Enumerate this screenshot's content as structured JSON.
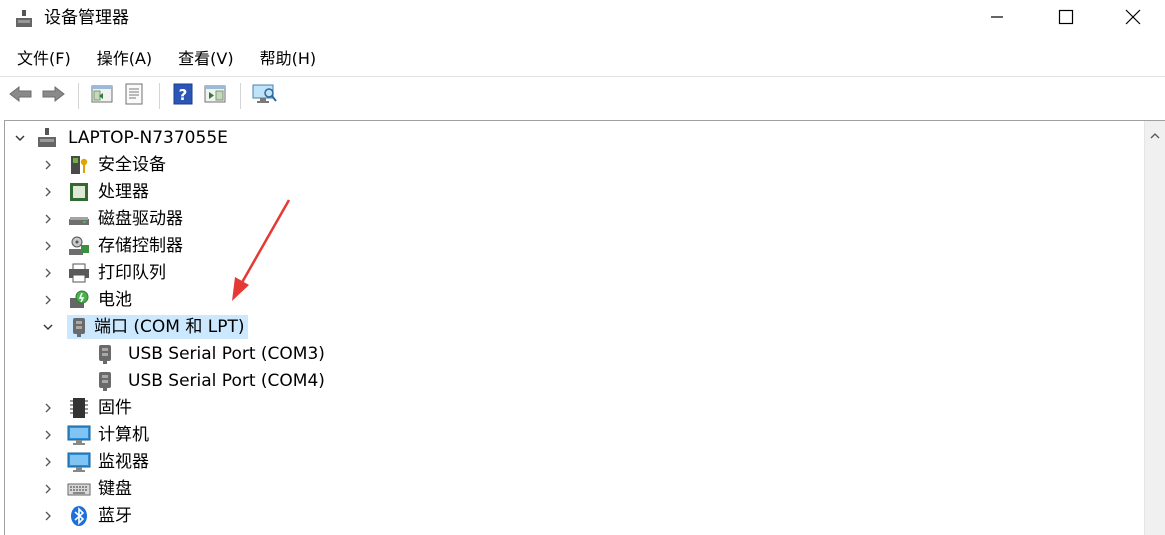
{
  "window": {
    "title": "设备管理器",
    "icons": {
      "app": "device-manager-icon",
      "minimize": "minimize-icon",
      "maximize": "maximize-icon",
      "close": "close-icon"
    }
  },
  "menu": {
    "items": [
      {
        "label": "文件(F)"
      },
      {
        "label": "操作(A)"
      },
      {
        "label": "查看(V)"
      },
      {
        "label": "帮助(H)"
      }
    ]
  },
  "toolbar": {
    "buttons": [
      {
        "icon": "back-arrow-icon"
      },
      {
        "icon": "forward-arrow-icon"
      },
      {
        "icon": "properties-panel-icon"
      },
      {
        "icon": "document-list-icon"
      },
      {
        "icon": "help-icon"
      },
      {
        "icon": "run-panel-icon"
      },
      {
        "icon": "scan-monitor-icon"
      }
    ]
  },
  "tree": {
    "root": {
      "label": "LAPTOP-N737055E",
      "icon": "computer-root-icon",
      "expanded": true
    },
    "items": [
      {
        "label": "安全设备",
        "icon": "security-device-icon",
        "expanded": false
      },
      {
        "label": "处理器",
        "icon": "processor-icon",
        "expanded": false
      },
      {
        "label": "磁盘驱动器",
        "icon": "disk-drive-icon",
        "expanded": false
      },
      {
        "label": "存储控制器",
        "icon": "storage-controller-icon",
        "expanded": false
      },
      {
        "label": "打印队列",
        "icon": "printer-icon",
        "expanded": false
      },
      {
        "label": "电池",
        "icon": "battery-icon",
        "expanded": false
      },
      {
        "label": "端口 (COM 和 LPT)",
        "icon": "port-icon",
        "expanded": true,
        "selected": true,
        "children": [
          {
            "label": "USB Serial Port (COM3)",
            "icon": "port-icon"
          },
          {
            "label": "USB Serial Port (COM4)",
            "icon": "port-icon"
          }
        ]
      },
      {
        "label": "固件",
        "icon": "firmware-icon",
        "expanded": false
      },
      {
        "label": "计算机",
        "icon": "monitor-icon",
        "expanded": false
      },
      {
        "label": "监视器",
        "icon": "monitor-icon",
        "expanded": false
      },
      {
        "label": "键盘",
        "icon": "keyboard-icon",
        "expanded": false
      },
      {
        "label": "蓝牙",
        "icon": "bluetooth-icon",
        "expanded": false
      }
    ]
  },
  "colors": {
    "selection": "#cce8ff",
    "annotation_arrow": "#e53935",
    "accent": "#1e6fd9"
  }
}
